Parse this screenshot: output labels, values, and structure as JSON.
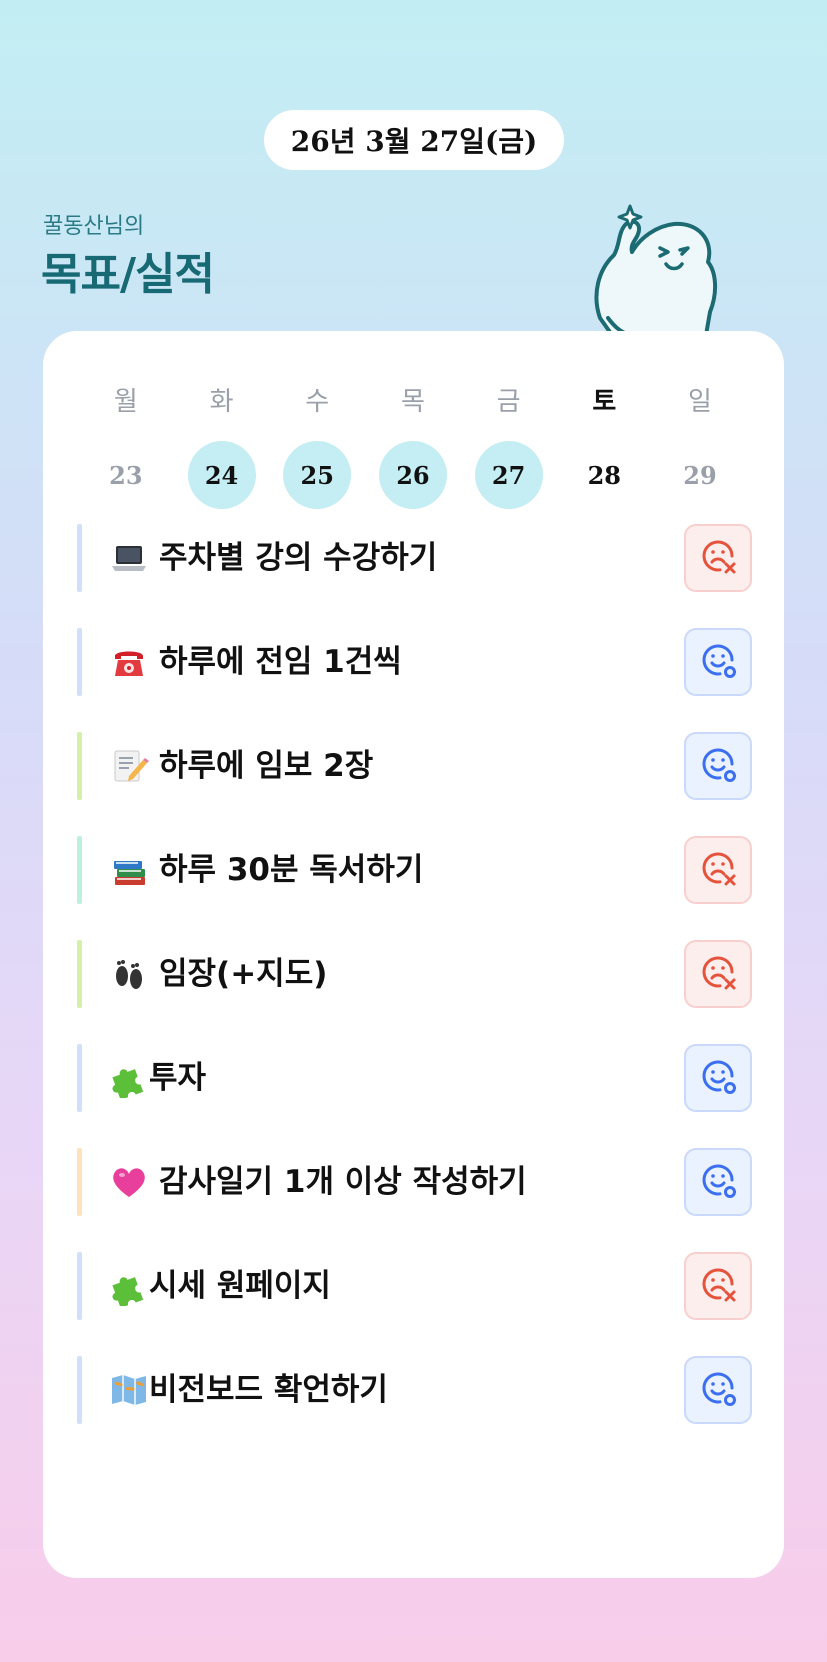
{
  "header": {
    "date": "26년 3월 27일(금)",
    "owner": "꿀동산님의",
    "title": "목표/실적"
  },
  "week": {
    "days_of_week": [
      "월",
      "화",
      "수",
      "목",
      "금",
      "토",
      "일"
    ],
    "dates": [
      "23",
      "24",
      "25",
      "26",
      "27",
      "28",
      "29"
    ],
    "completed": [
      false,
      true,
      true,
      true,
      true,
      false,
      false
    ],
    "today_index": 5
  },
  "colors": {
    "bar_blue": "#d3defa",
    "bar_green": "#d6f0a8",
    "bar_mint": "#bdf0dd",
    "bar_peach": "#fde2bd",
    "fail": "#e5533c",
    "ok": "#3b6ff0",
    "highlight": "#c4eef3",
    "title": "#176a74"
  },
  "goals": [
    {
      "icon": "laptop-icon",
      "label": "주차별 강의 수강하기",
      "status": "fail",
      "bar": "blue"
    },
    {
      "icon": "telephone-icon",
      "label": "하루에 전임 1건씩",
      "status": "ok",
      "bar": "blue"
    },
    {
      "icon": "memo-icon",
      "label": "하루에 임보 2장",
      "status": "ok",
      "bar": "green"
    },
    {
      "icon": "books-icon",
      "label": "하루 30분 독서하기",
      "status": "fail",
      "bar": "mint"
    },
    {
      "icon": "footprints-icon",
      "label": "임장(+지도)",
      "status": "fail",
      "bar": "green"
    },
    {
      "icon": "puzzle-icon",
      "label": "투자",
      "status": "ok",
      "bar": "blue"
    },
    {
      "icon": "heart-icon",
      "label": "감사일기 1개 이상 작성하기",
      "status": "ok",
      "bar": "peach"
    },
    {
      "icon": "puzzle-icon",
      "label": "시세 원페이지",
      "status": "fail",
      "bar": "blue"
    },
    {
      "icon": "map-icon",
      "label": "비전보드 확언하기",
      "status": "ok",
      "bar": "blue"
    }
  ]
}
